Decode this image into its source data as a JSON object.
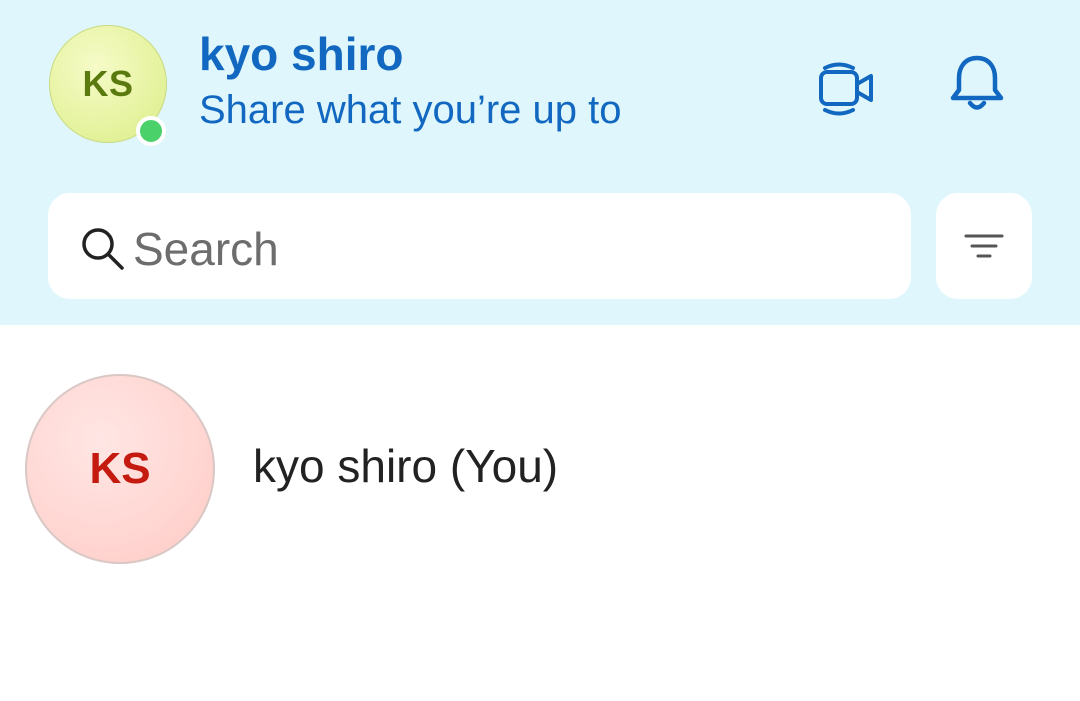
{
  "header": {
    "avatar_initials": "KS",
    "profile_name": "kyo shiro",
    "status_text": "Share what you’re up to",
    "presence": "online",
    "icons": [
      "video-call-icon",
      "bell-icon"
    ]
  },
  "search": {
    "placeholder": "Search",
    "value": "",
    "filter_icon": "filter-icon"
  },
  "contacts": [
    {
      "initials": "KS",
      "name": "kyo shiro (You)"
    }
  ],
  "colors": {
    "header_bg": "#dff7fc",
    "accent_blue": "#1268c0",
    "presence_green": "#4bd16a",
    "contact_initials_red": "#c41a10"
  }
}
